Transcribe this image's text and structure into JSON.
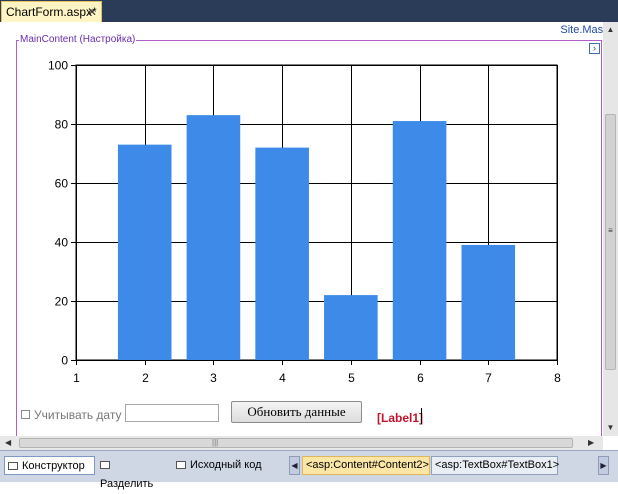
{
  "tab": {
    "title": "ChartForm.aspx*",
    "close": "✕"
  },
  "site_master": "Site.Master",
  "content_placeholder": {
    "label": "MainContent (Настройка)",
    "expand": "›"
  },
  "chart_data": {
    "type": "bar",
    "x": [
      2,
      3,
      4,
      5,
      6,
      7
    ],
    "values": [
      73,
      83,
      72,
      22,
      81,
      39
    ],
    "xlim": [
      1,
      8
    ],
    "ylim": [
      0,
      100
    ],
    "x_ticks": [
      "1",
      "2",
      "3",
      "4",
      "5",
      "6",
      "7",
      "8"
    ],
    "y_ticks": [
      "0",
      "20",
      "40",
      "60",
      "80",
      "100"
    ],
    "grid": true,
    "bar_color": "#3d8ae8"
  },
  "form": {
    "checkbox_label": "Учитывать дату",
    "date_value": "",
    "update_button": "Обновить данные",
    "label1": "[Label1]"
  },
  "views": {
    "designer": "Конструктор",
    "split": "Разделить",
    "source": "Исходный код"
  },
  "breadcrumbs": [
    "<asp:Content#Content2>",
    "<asp:TextBox#TextBox1>"
  ],
  "colors": {
    "titlebar": "#2b3c59",
    "active_tab": "#fff5c4",
    "content_border": "#b05ec9",
    "label_red": "#c0142d"
  }
}
